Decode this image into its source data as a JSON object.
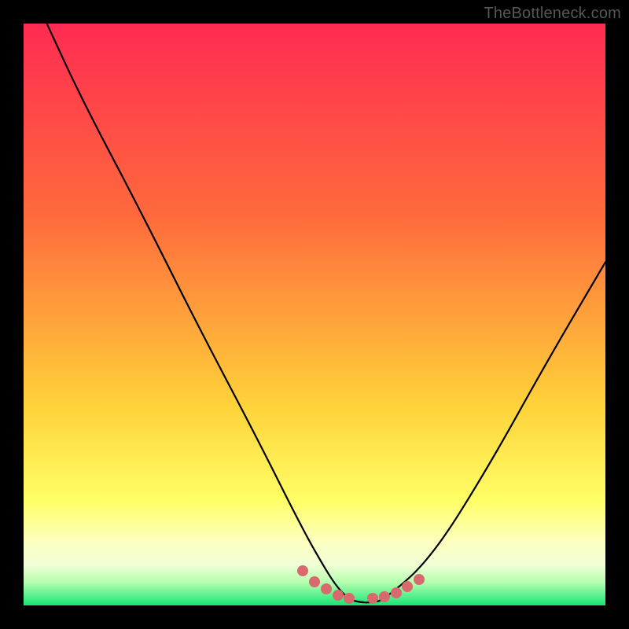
{
  "watermark": "TheBottleneck.com",
  "colors": {
    "top": "#ff2b52",
    "upper": "#ff6a3c",
    "mid": "#ffd33a",
    "lower": "#ffff66",
    "pale": "#fcffbf",
    "cream": "#f1ffd6",
    "green1": "#b9ffb0",
    "green2": "#5cff85",
    "green3": "#18e574",
    "curve": "#000000",
    "dot": "#d86a6d"
  },
  "chart_data": {
    "type": "line",
    "title": "",
    "xlabel": "",
    "ylabel": "",
    "xlim": [
      0,
      100
    ],
    "ylim": [
      0,
      100
    ],
    "curve_black": {
      "x": [
        4,
        10,
        20,
        30,
        40,
        48,
        52,
        54,
        56,
        58,
        60,
        62,
        70,
        80,
        90,
        100
      ],
      "y": [
        100,
        87,
        68,
        48,
        29,
        13,
        6,
        3,
        1,
        0.5,
        0.5,
        1,
        8,
        24,
        42,
        59
      ]
    },
    "dotted_segment": {
      "x": [
        48,
        50,
        52,
        54,
        56,
        60,
        62,
        64,
        66,
        68
      ],
      "y": [
        6,
        4,
        2.8,
        1.8,
        1.2,
        1.2,
        1.5,
        2.2,
        3.2,
        4.5
      ]
    }
  }
}
